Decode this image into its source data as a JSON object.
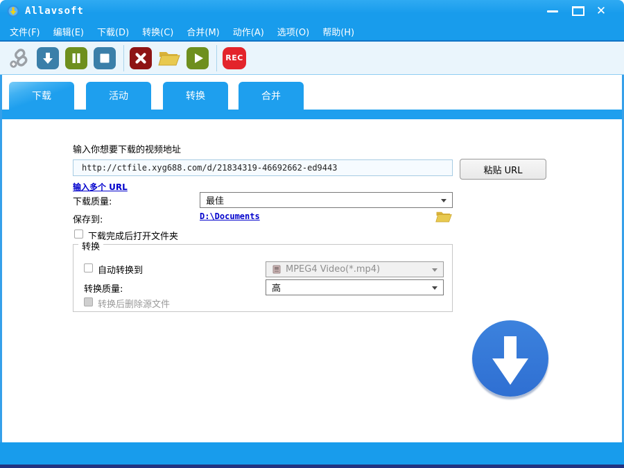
{
  "window": {
    "title": "Allavsoft",
    "controls": {
      "close_glyph": "✕"
    }
  },
  "menubar": {
    "items": [
      {
        "label": "文件(F)"
      },
      {
        "label": "编辑(E)"
      },
      {
        "label": "下载(D)"
      },
      {
        "label": "转换(C)"
      },
      {
        "label": "合并(M)"
      },
      {
        "label": "动作(A)"
      },
      {
        "label": "选项(O)"
      },
      {
        "label": "帮助(H)"
      }
    ]
  },
  "toolbar": {
    "rec_label": "REC",
    "icons": [
      "add-url-link",
      "start-download",
      "pause",
      "stop",
      "cancel",
      "open-folder",
      "play",
      "record"
    ]
  },
  "tabs": [
    {
      "label": "下载",
      "active": true
    },
    {
      "label": "活动",
      "active": false
    },
    {
      "label": "转换",
      "active": false
    },
    {
      "label": "合并",
      "active": false
    }
  ],
  "form": {
    "url_label": "输入你想要下载的视频地址",
    "url_value": "http://ctfile.xyg688.com/d/21834319-46692662-ed9443",
    "paste_button": "粘贴 URL",
    "multi_url_link": "输入多个 URL",
    "quality_label": "下载质量:",
    "quality_value": "最佳",
    "save_label": "保存到:",
    "save_path": "D:\\Documents",
    "open_folder_checkbox": "下载完成后打开文件夹",
    "convert_group": {
      "legend": "转换",
      "auto_convert_checkbox": "自动转换到",
      "format_value": "MPEG4 Video(*.mp4)",
      "convert_quality_label": "转换质量:",
      "convert_quality_value": "高",
      "delete_source_checkbox": "转换后删除源文件"
    }
  },
  "colors": {
    "titlebar_blue": "#189CEC",
    "tab_blue": "#1E9FEE",
    "toolbar_bg": "#EAF5FC",
    "big_button_blue": "#3577D8",
    "link_blue": "#0000CC",
    "footer_dark": "#223380",
    "btn_steel_blue": "#3B7FA9",
    "btn_olive": "#6E8F1E",
    "btn_dark_red": "#8E1414",
    "btn_rec_red": "#E3242B",
    "folder_gold": "#E8C94F"
  }
}
